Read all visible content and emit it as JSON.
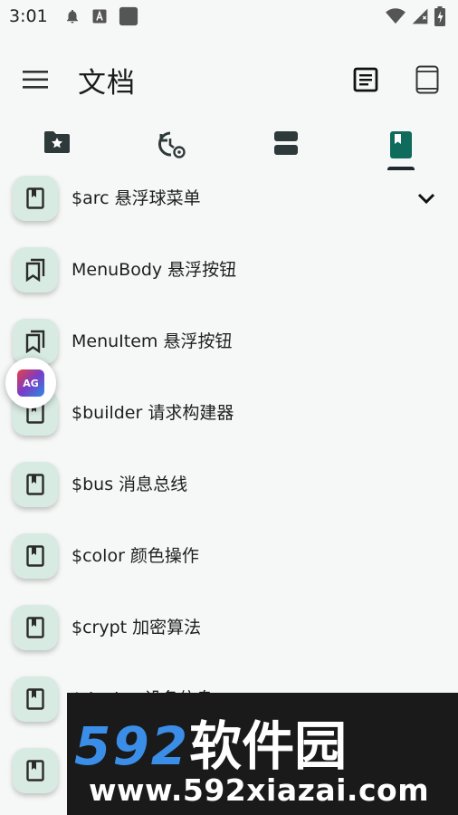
{
  "status_bar": {
    "time": "3:01"
  },
  "app_bar": {
    "title": "文档"
  },
  "tabs": [
    {
      "icon": "folder-star-icon"
    },
    {
      "icon": "history-settings-icon"
    },
    {
      "icon": "view-agenda-icon"
    },
    {
      "icon": "book-icon",
      "selected": true
    }
  ],
  "list": [
    {
      "label": "$arc 悬浮球菜单",
      "icon": "book-icon",
      "expandable": true
    },
    {
      "label": "MenuBody 悬浮按钮",
      "icon": "bookmarks-icon"
    },
    {
      "label": "MenuItem 悬浮按钮",
      "icon": "bookmarks-icon"
    },
    {
      "label": "$builder 请求构建器",
      "icon": "book-icon"
    },
    {
      "label": "$bus 消息总线",
      "icon": "book-icon"
    },
    {
      "label": "$color 颜色操作",
      "icon": "book-icon"
    },
    {
      "label": "$crypt 加密算法",
      "icon": "book-icon"
    },
    {
      "label": "$device 设备信息",
      "icon": "book-icon"
    },
    {
      "label": "",
      "icon": "book-icon"
    }
  ],
  "floating_badge": {
    "text": "AG"
  },
  "watermark": {
    "brand_digits": "592",
    "brand_cn": "软件园",
    "url": "www.592xiazai.com"
  },
  "colors": {
    "accent": "#0f6b5c",
    "icon_bg": "#d8ebe3",
    "background": "#f6f8f7"
  }
}
